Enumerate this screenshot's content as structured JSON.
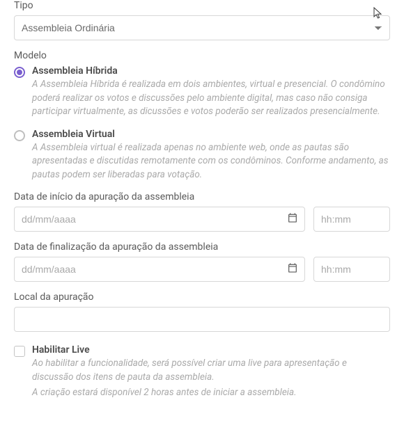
{
  "tipo": {
    "label": "Tipo",
    "selected": "Assembleia Ordinária"
  },
  "modelo": {
    "label": "Modelo",
    "options": [
      {
        "title": "Assembleia Híbrida",
        "desc": "A Assembleia Híbrida é realizada em dois ambientes, virtual e presencial. O condômino poderá realizar os votos e discussões pelo ambiente digital, mas caso não consiga participar virtualmente, as dicussões e votos poderão ser realizados presencialmente.",
        "selected": true
      },
      {
        "title": "Assembleia Virtual",
        "desc": "A Assembleia virtual é realizada apenas no ambiente web, onde as pautas são apresentadas e discutidas remotamente com os condôminos. Conforme andamento, as pautas podem ser liberadas para votação.",
        "selected": false
      }
    ]
  },
  "start": {
    "label": "Data de início da apuração da assembleia",
    "date_placeholder": "dd/mm/aaaa",
    "time_placeholder": "hh:mm"
  },
  "end": {
    "label": "Data de finalização da apuração da assembleia",
    "date_placeholder": "dd/mm/aaaa",
    "time_placeholder": "hh:mm"
  },
  "local": {
    "label": "Local da apuração"
  },
  "live": {
    "title": "Habilitar Live",
    "desc1": "Ao habilitar a funcionalidade, será possível criar uma live para apresentação e discussão dos itens de pauta da assembleia.",
    "desc2": "A criação estará disponível 2 horas antes de iniciar a assembleia."
  }
}
